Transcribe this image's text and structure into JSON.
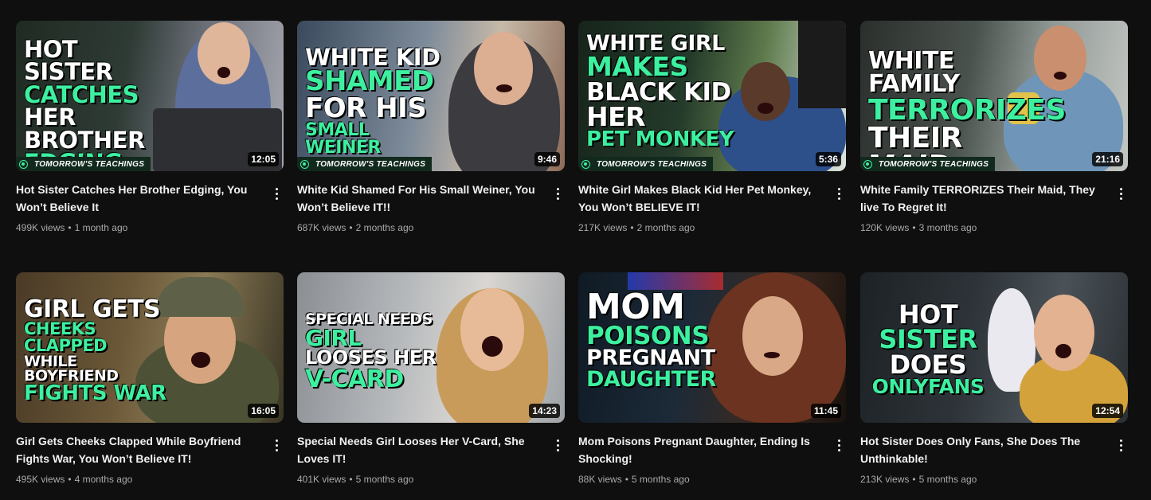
{
  "channel_brand": "TOMORROW'S TEACHINGS",
  "videos": [
    {
      "title": "Hot Sister Catches Her Brother Edging, You Won’t Believe It",
      "views": "499K views",
      "age": "1 month ago",
      "duration": "12:05",
      "thumb_text": [
        "HOT SISTER",
        "CATCHES",
        "HER BROTHER",
        "EDGING"
      ]
    },
    {
      "title": "White Kid Shamed For His Small Weiner, You Won’t Believe IT!!",
      "views": "687K views",
      "age": "2 months ago",
      "duration": "9:46",
      "thumb_text": [
        "WHITE KID",
        "SHAMED",
        "FOR HIS",
        "SMALL WEINER"
      ]
    },
    {
      "title": "White Girl Makes Black Kid Her Pet Monkey, You Won’t BELIEVE IT!",
      "views": "217K views",
      "age": "2 months ago",
      "duration": "5:36",
      "thumb_text": [
        "WHITE GIRL",
        "MAKES",
        "BLACK KID",
        "HER",
        "PET MONKEY"
      ]
    },
    {
      "title": "White Family TERRORIZES Their Maid, They live To Regret It!",
      "views": "120K views",
      "age": "3 months ago",
      "duration": "21:16",
      "thumb_text": [
        "WHITE FAMILY",
        "TERRORIZES",
        "THEIR MAID"
      ]
    },
    {
      "title": "Girl Gets Cheeks Clapped While Boyfriend Fights War, You Won’t Believe IT!",
      "views": "495K views",
      "age": "4 months ago",
      "duration": "16:05",
      "thumb_text": [
        "GIRL GETS",
        "CHEEKS CLAPPED",
        "WHILE BOYFRIEND",
        "FIGHTS WAR"
      ]
    },
    {
      "title": "Special Needs Girl Looses Her V-Card, She Loves IT!",
      "views": "401K views",
      "age": "5 months ago",
      "duration": "14:23",
      "thumb_text": [
        "SPECIAL NEEDS",
        "GIRL",
        "LOOSES HER",
        "V-CARD"
      ]
    },
    {
      "title": "Mom Poisons Pregnant Daughter, Ending Is Shocking!",
      "views": "88K views",
      "age": "5 months ago",
      "duration": "11:45",
      "thumb_text": [
        "MOM",
        "POISONS",
        "PREGNANT",
        "DAUGHTER"
      ]
    },
    {
      "title": "Hot Sister Does Only Fans, She Does The Unthinkable!",
      "views": "213K views",
      "age": "5 months ago",
      "duration": "12:54",
      "thumb_text": [
        "HOT",
        "SISTER",
        "DOES",
        "ONLYFANS"
      ]
    }
  ],
  "colors": {
    "accent_green": "#3df0a0",
    "background": "#0f0f0f",
    "meta_text": "#aaaaaa"
  }
}
